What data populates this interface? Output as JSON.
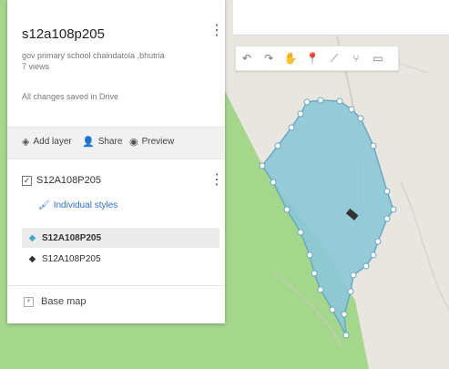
{
  "map": {
    "water_color": "#e9e6df",
    "park_color": "#a4d68c",
    "polygon_fill": "#8cc8d8",
    "polygon_stroke": "#6aa9c0"
  },
  "toolbar": {
    "tools": [
      {
        "icon": "undo-icon",
        "glyph": "↶"
      },
      {
        "icon": "redo-icon",
        "glyph": "↷"
      },
      {
        "icon": "hand-icon",
        "glyph": "✋"
      },
      {
        "icon": "marker-icon",
        "glyph": "📍"
      },
      {
        "icon": "draw-line-icon",
        "glyph": "⟋"
      },
      {
        "icon": "directions-icon",
        "glyph": "⑂"
      },
      {
        "icon": "ruler-icon",
        "glyph": "▭"
      }
    ]
  },
  "panel": {
    "title": "s12a108p205",
    "description": "gov primary school chaindatola ,bhutria",
    "views": "7 views",
    "saved_status": "All changes saved in Drive",
    "actions": {
      "add_layer": "Add layer",
      "share": "Share",
      "preview": "Preview"
    },
    "layer": {
      "name": "S12A108P205",
      "style_link": "Individual styles",
      "features": [
        {
          "label": "S12A108P205",
          "selected": true,
          "icon_color": "#4aa6cf"
        },
        {
          "label": "S12A108P205",
          "selected": false,
          "icon_color": "#333333"
        }
      ]
    },
    "base_map": "Base map"
  }
}
